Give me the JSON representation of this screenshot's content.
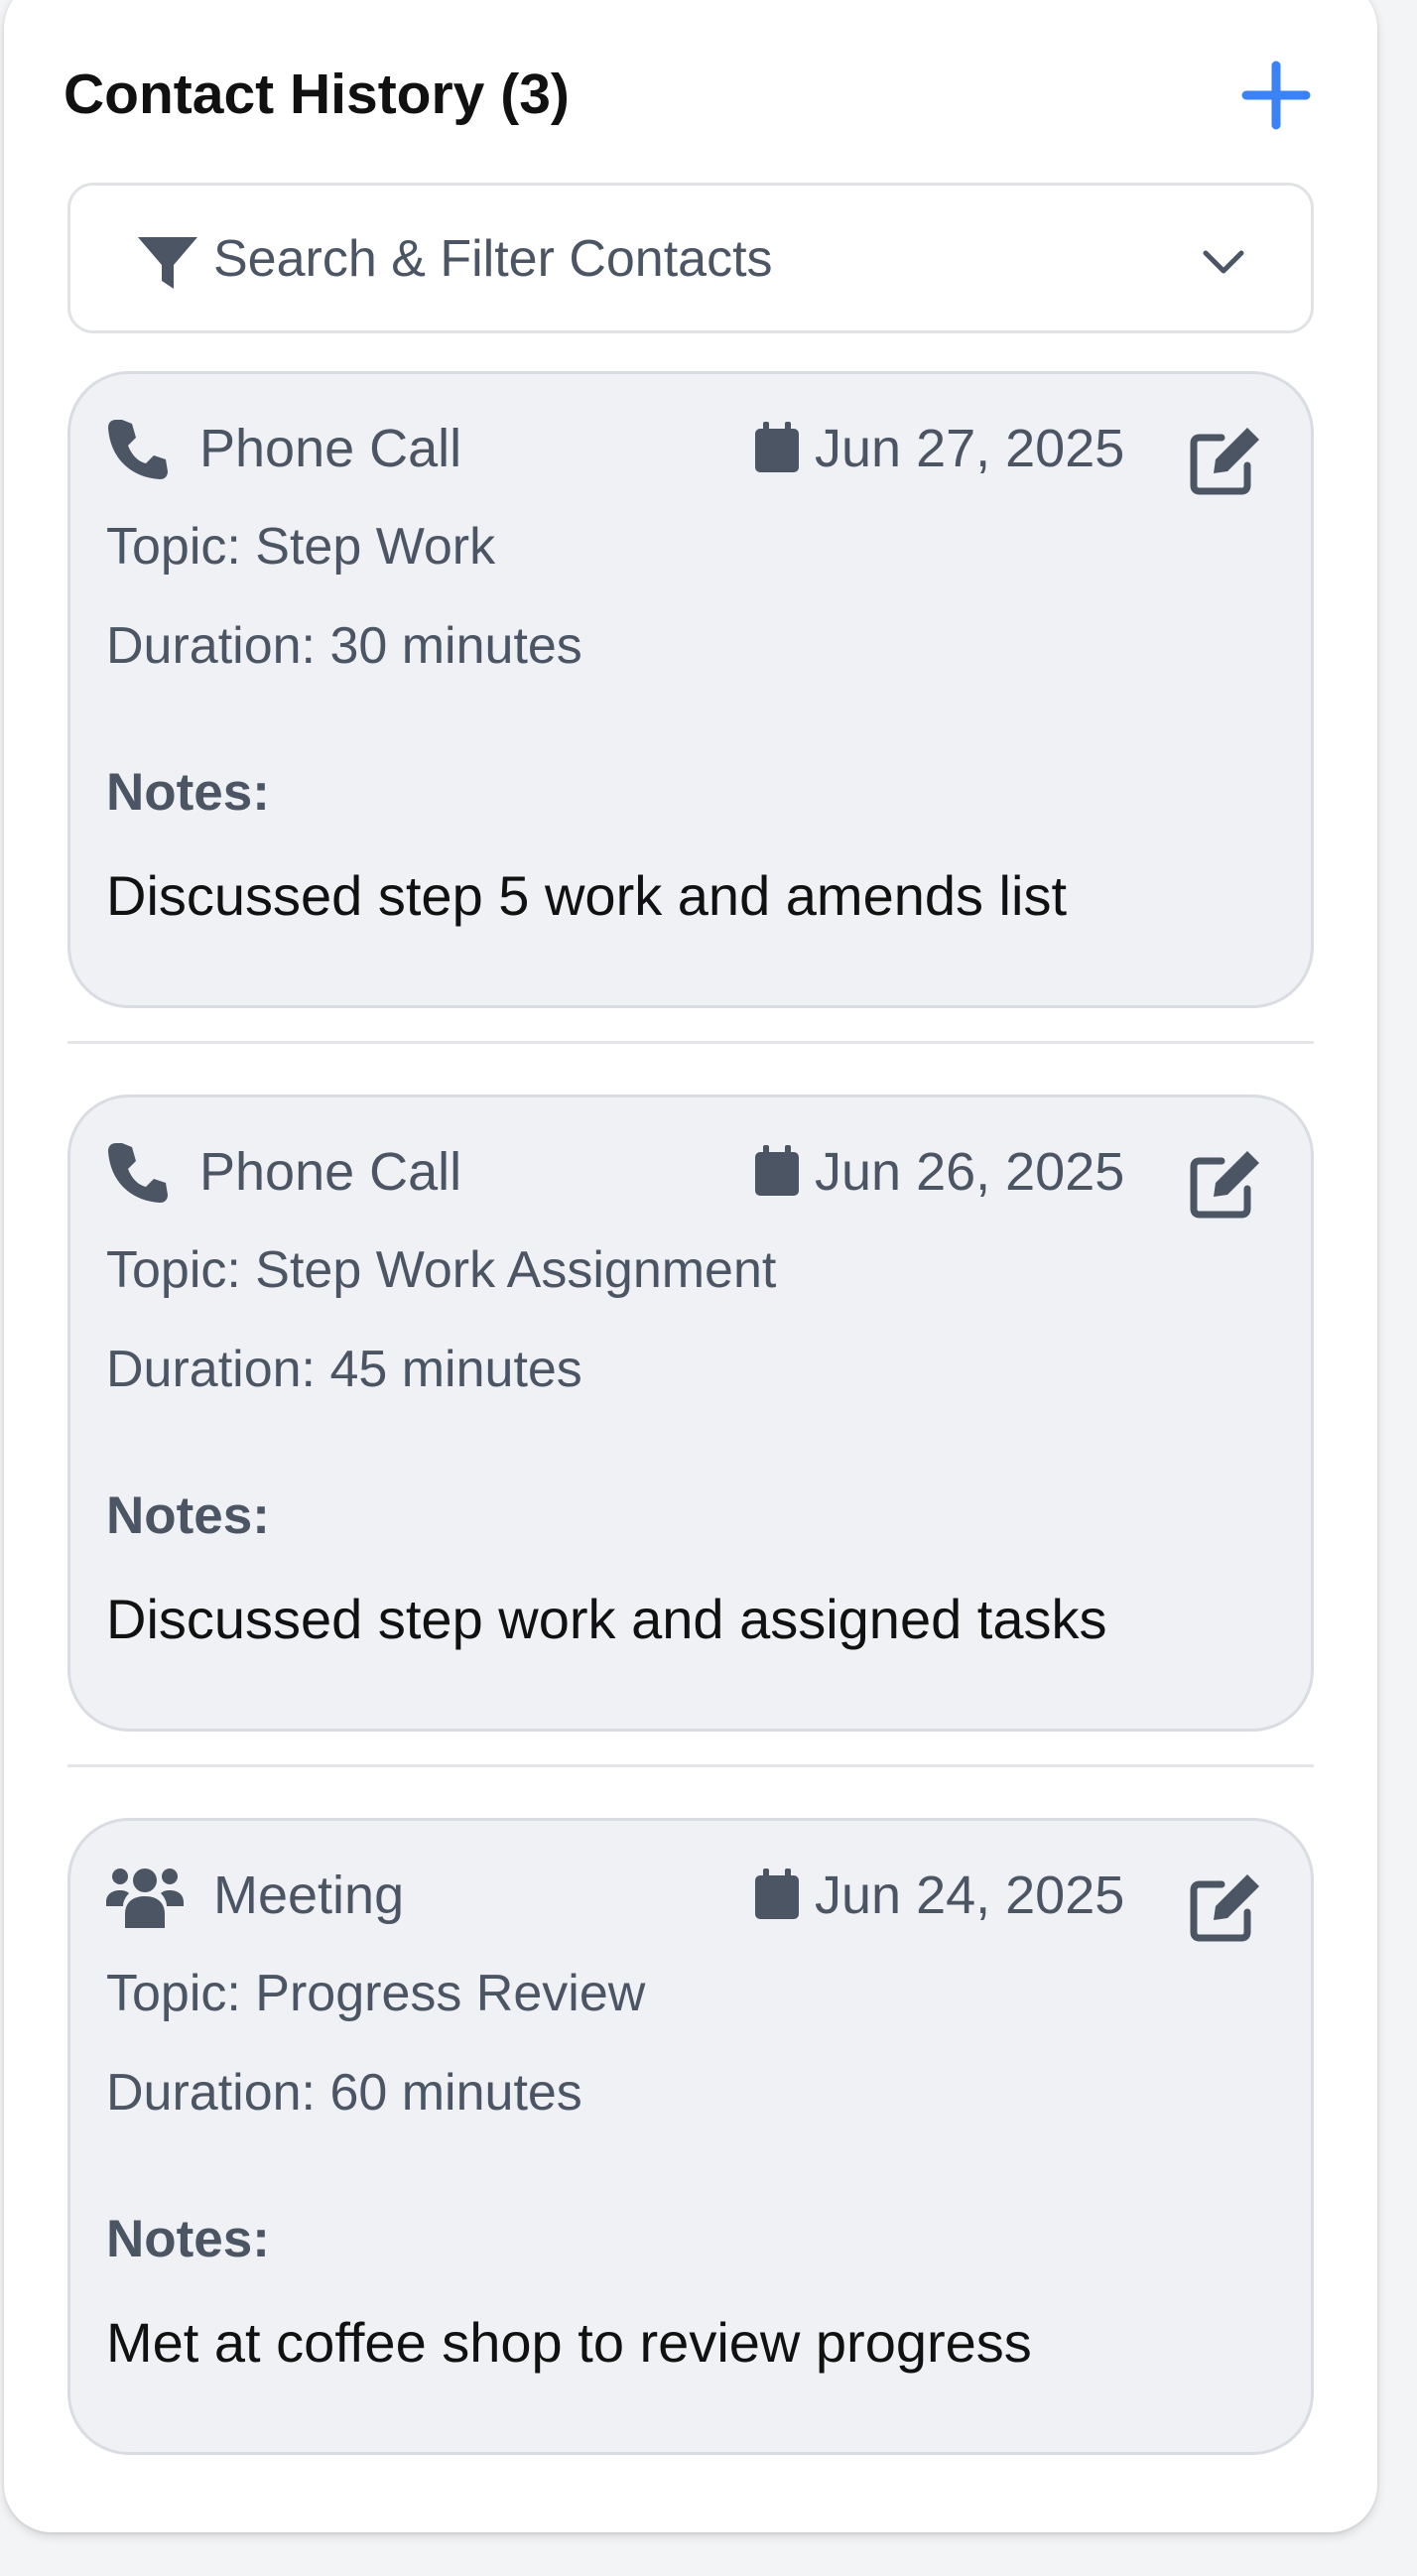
{
  "header": {
    "title": "Contact History (3)",
    "add_icon": "plus-icon"
  },
  "filter": {
    "label": "Search & Filter Contacts",
    "icon": "funnel-icon",
    "toggle_icon": "chevron-down-icon"
  },
  "contacts": [
    {
      "type": "Phone Call",
      "type_icon": "phone-icon",
      "date": "Jun 27, 2025",
      "topic": "Topic: Step Work",
      "duration": "Duration: 30 minutes",
      "notes_label": "Notes:",
      "notes": "Discussed step 5 work and amends list"
    },
    {
      "type": "Phone Call",
      "type_icon": "phone-icon",
      "date": "Jun 26, 2025",
      "topic": "Topic: Step Work Assignment",
      "duration": "Duration: 45 minutes",
      "notes_label": "Notes:",
      "notes": "Discussed step work and assigned tasks"
    },
    {
      "type": "Meeting",
      "type_icon": "users-icon",
      "date": "Jun 24, 2025",
      "topic": "Topic: Progress Review",
      "duration": "Duration: 60 minutes",
      "notes_label": "Notes:",
      "notes": "Met at coffee shop to review progress"
    }
  ],
  "colors": {
    "accent": "#3b82f6",
    "icon": "#4b5563",
    "card_bg": "#eff1f5"
  }
}
